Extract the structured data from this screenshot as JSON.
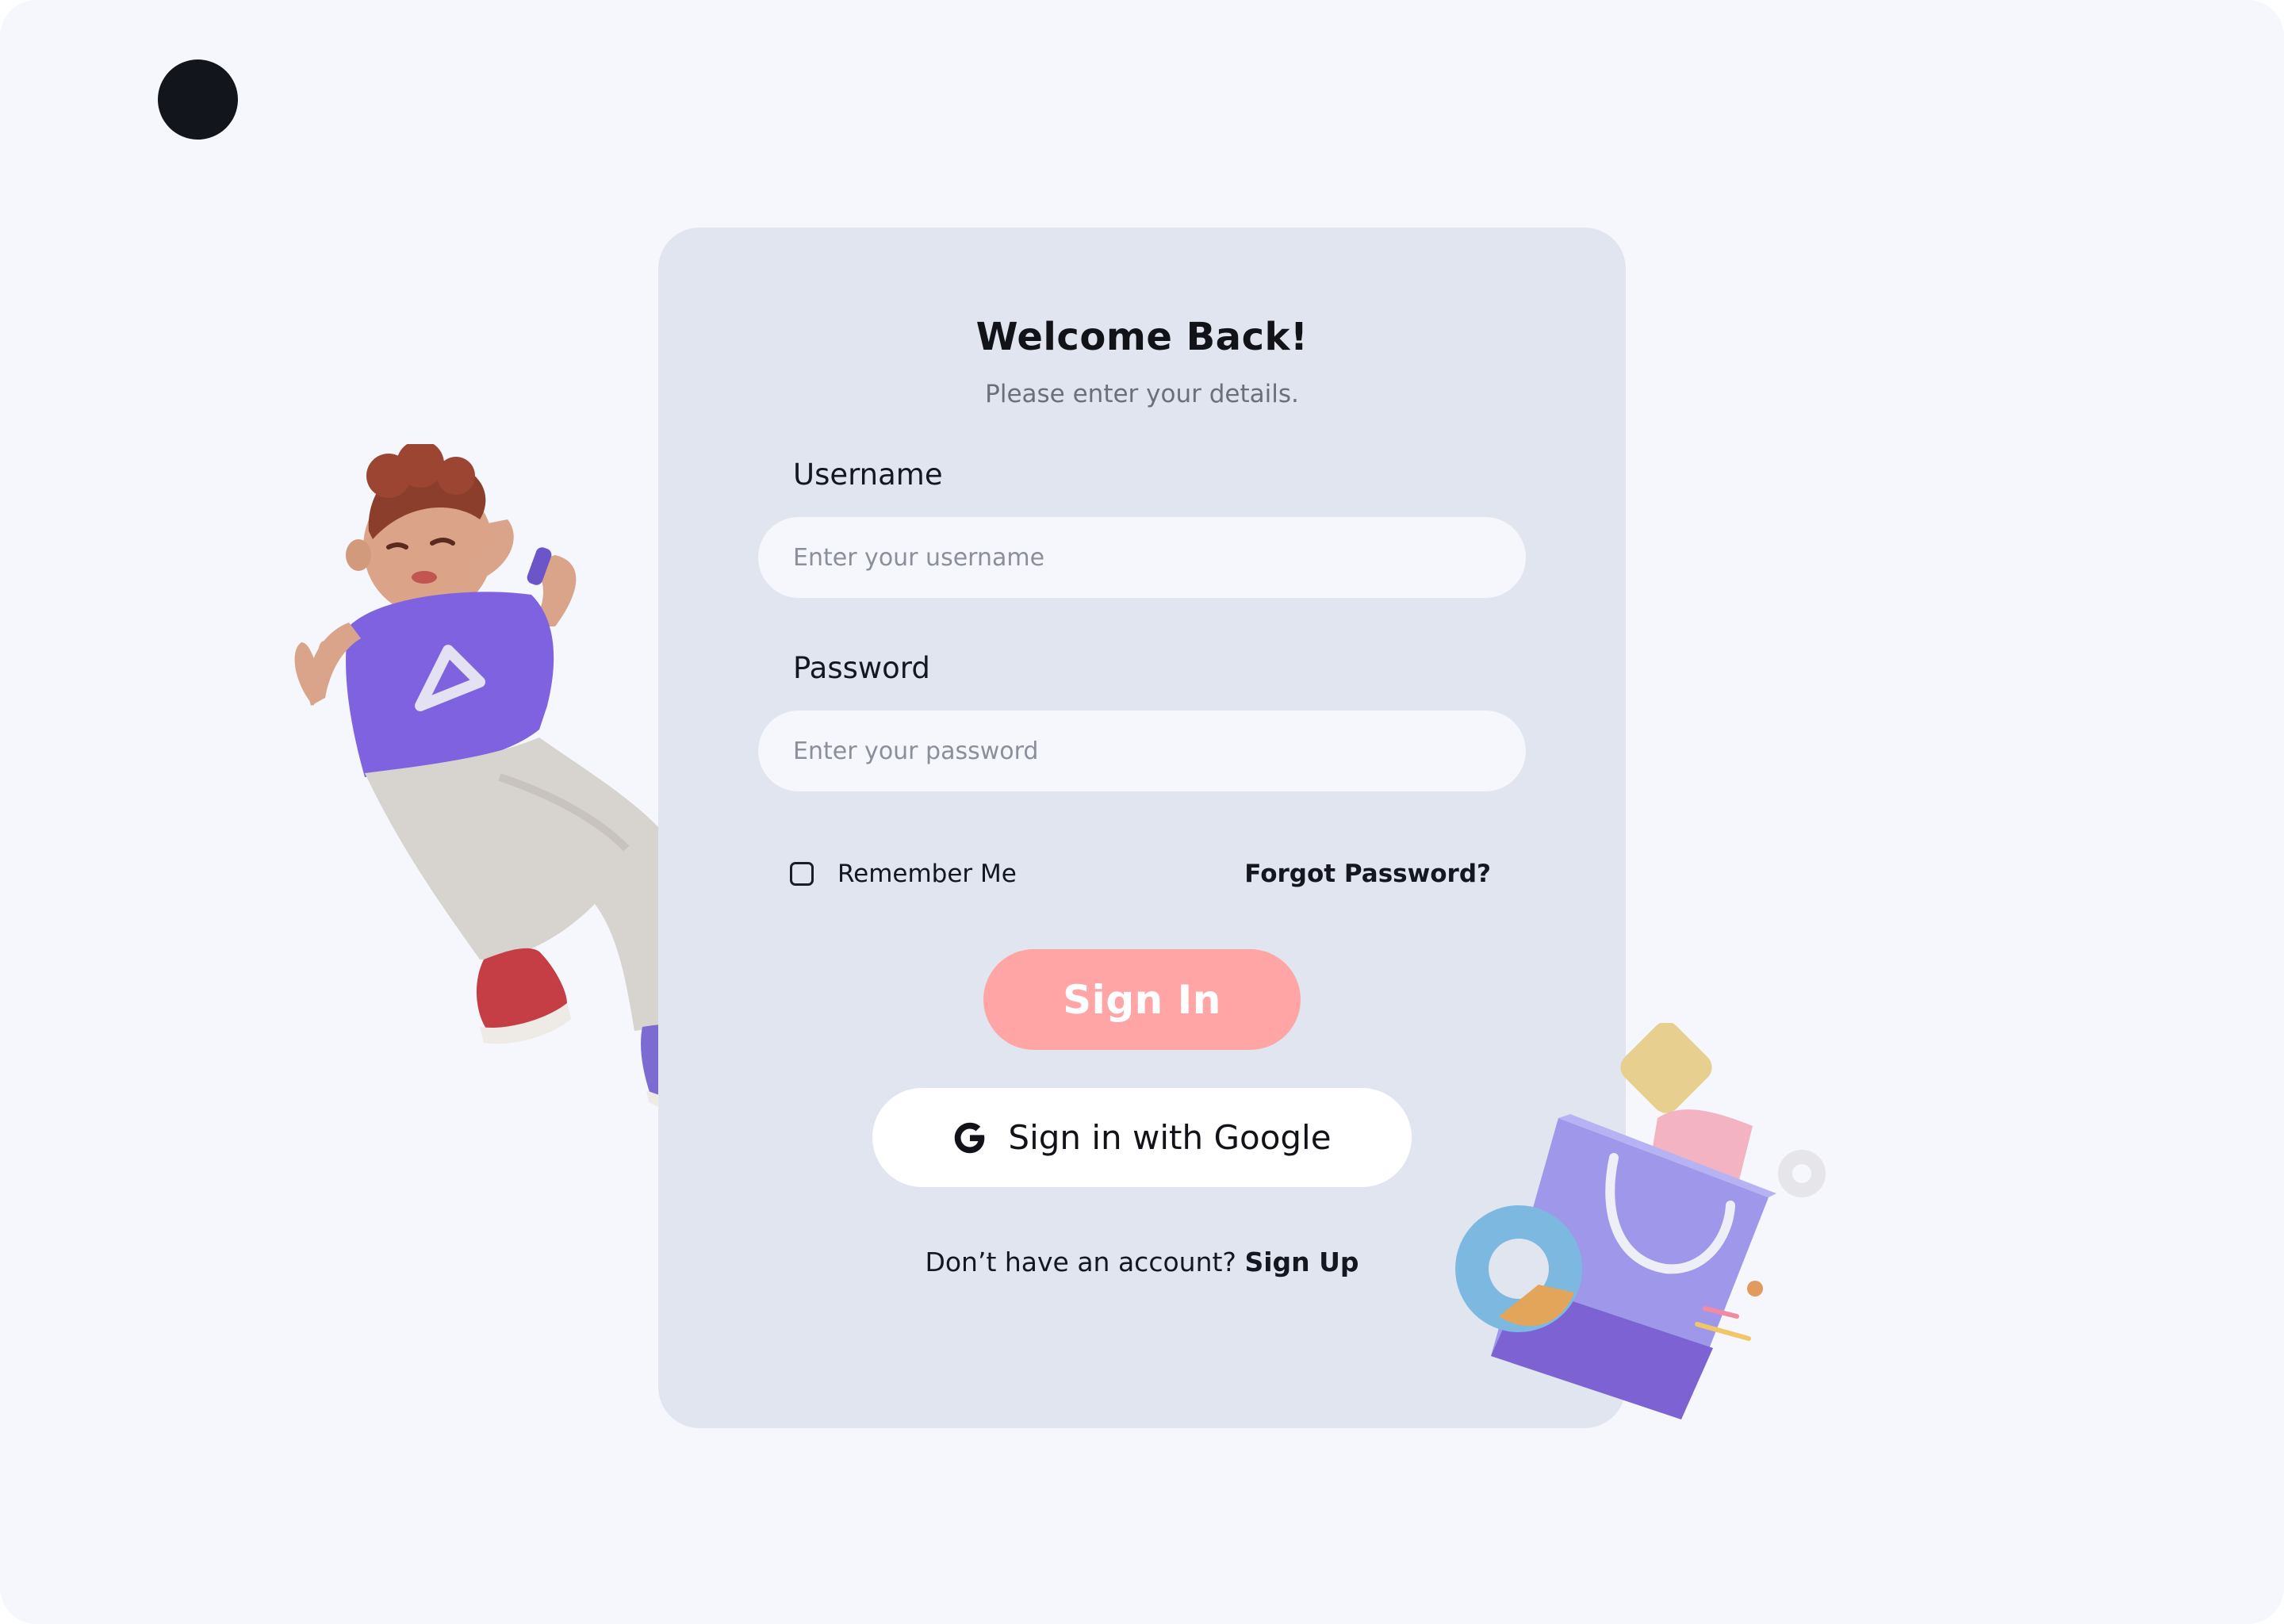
{
  "card": {
    "title": "Welcome Back!",
    "subtitle": "Please enter your details."
  },
  "form": {
    "username_label": "Username",
    "username_placeholder": "Enter your username",
    "username_value": "",
    "password_label": "Password",
    "password_placeholder": "Enter your password",
    "password_value": "",
    "remember_label": "Remember Me",
    "remember_checked": false,
    "forgot_label": "Forgot Password?",
    "signin_label": "Sign In",
    "google_label": "Sign in with Google",
    "signup_prompt": "Don’t have an account?",
    "signup_link": "Sign Up"
  },
  "icons": {
    "logo": "logo-dot",
    "google": "google-icon",
    "checkbox": "checkbox-unchecked"
  },
  "colors": {
    "page_background": "#f5f7fc",
    "card_background": "#e1e5ef",
    "signin_button": "#ffa5a6",
    "logo": "#12151b",
    "text": "#141720",
    "subtitle": "#6a6f7c",
    "shirt_purple": "#7e62e0"
  }
}
